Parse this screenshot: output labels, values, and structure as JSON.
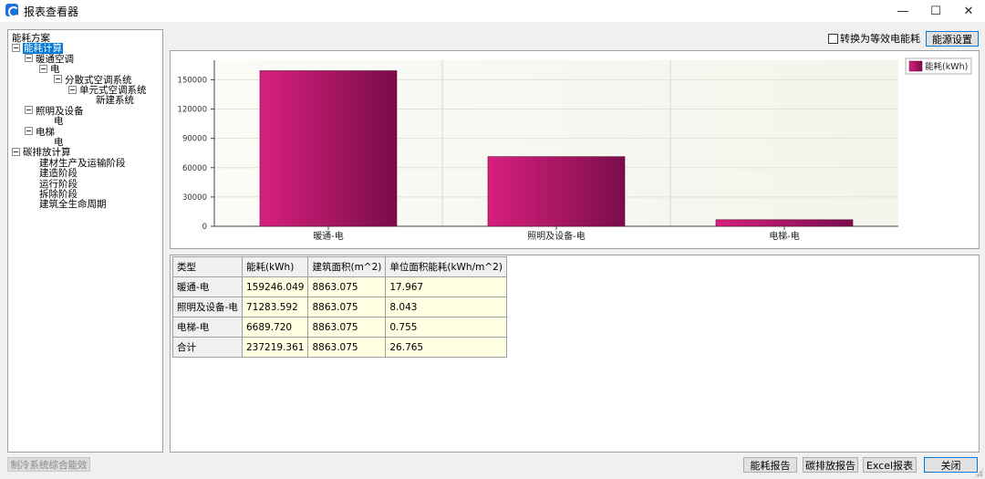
{
  "window": {
    "title": "报表查看器",
    "minimize_glyph": "—",
    "maximize_glyph": "☐",
    "close_glyph": "✕"
  },
  "tree": [
    {
      "label": "能耗方案",
      "toggle": false,
      "selected": false
    },
    {
      "label": "能耗计算",
      "toggle": true,
      "selected": true
    },
    {
      "label": "暖通空调",
      "toggle": true,
      "selected": false
    },
    {
      "label": "电",
      "toggle": true,
      "selected": false
    },
    {
      "label": "分散式空调系统",
      "toggle": true,
      "selected": false
    },
    {
      "label": "单元式空调系统",
      "toggle": true,
      "selected": false
    },
    {
      "label": "新建系统",
      "toggle": false,
      "selected": false
    },
    {
      "label": "照明及设备",
      "toggle": true,
      "selected": false
    },
    {
      "label": "电",
      "toggle": false,
      "selected": false
    },
    {
      "label": "电梯",
      "toggle": true,
      "selected": false
    },
    {
      "label": "电",
      "toggle": false,
      "selected": false
    },
    {
      "label": "碳排放计算",
      "toggle": true,
      "selected": false
    },
    {
      "label": "建材生产及运输阶段",
      "toggle": false,
      "selected": false
    },
    {
      "label": "建造阶段",
      "toggle": false,
      "selected": false
    },
    {
      "label": "运行阶段",
      "toggle": false,
      "selected": false
    },
    {
      "label": "拆除阶段",
      "toggle": false,
      "selected": false
    },
    {
      "label": "建筑全生命周期",
      "toggle": false,
      "selected": false
    }
  ],
  "controls": {
    "convert_label": "转换为等效电能耗",
    "energy_settings_label": "能源设置"
  },
  "chart_data": {
    "type": "bar",
    "categories": [
      "暖通-电",
      "照明及设备-电",
      "电梯-电"
    ],
    "series": [
      {
        "name": "能耗(kWh)",
        "values": [
          159246.049,
          71283.592,
          6689.72
        ]
      }
    ],
    "yticks": [
      "0",
      "30000",
      "60000",
      "90000",
      "120000",
      "150000"
    ],
    "ylim": [
      0,
      170000
    ],
    "grid": true,
    "legend_position": "top-right",
    "colors": {
      "bar_light": "#d8207c",
      "bar_dark": "#7a0c4c",
      "plot_bg": "#f4f4ec"
    }
  },
  "table": {
    "headers": [
      "类型",
      "能耗(kWh)",
      "建筑面积(m^2)",
      "单位面积能耗(kWh/m^2)"
    ],
    "rows": [
      [
        "暖通-电",
        "159246.049",
        "8863.075",
        "17.967"
      ],
      [
        "照明及设备-电",
        "71283.592",
        "8863.075",
        "8.043"
      ],
      [
        "电梯-电",
        "6689.720",
        "8863.075",
        "0.755"
      ],
      [
        "合计",
        "237219.361",
        "8863.075",
        "26.765"
      ]
    ]
  },
  "bottom": {
    "disabled_label": "制冷系统综合能效",
    "buttons": [
      "能耗报告",
      "碳排放报告",
      "Excel报表",
      "关闭"
    ]
  }
}
